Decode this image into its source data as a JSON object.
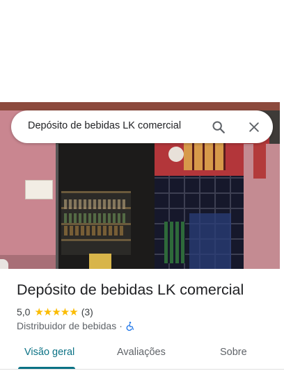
{
  "search": {
    "query": "Depósito de bebidas LK comercial",
    "search_icon": "search-icon",
    "close_icon": "close-icon"
  },
  "photo": {
    "description_icon": "storefront-photo"
  },
  "place": {
    "title": "Depósito de bebidas LK comercial",
    "rating": "5,0",
    "stars": "★★★★★",
    "reviews": "(3)",
    "category": "Distribuidor de bebidas",
    "separator": "·",
    "accessibility_icon": "wheelchair-accessible-icon"
  },
  "tabs": [
    {
      "label": "Visão geral",
      "active": true
    },
    {
      "label": "Avaliações",
      "active": false
    },
    {
      "label": "Sobre",
      "active": false
    }
  ],
  "colors": {
    "accent": "#0b7285",
    "star": "#fbbc04",
    "accessibility": "#1a73e8"
  }
}
